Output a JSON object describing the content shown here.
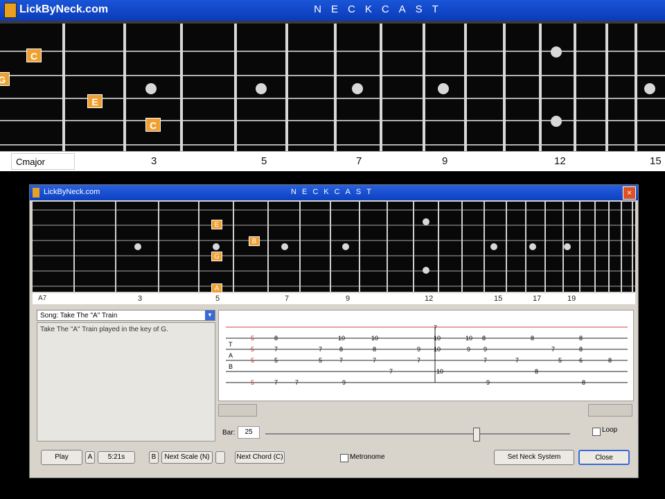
{
  "top_window": {
    "app_name": "LickByNeck.com",
    "brand": "NECKCAST",
    "chord_label": "Cmajor",
    "fret_markers": [
      "3",
      "5",
      "7",
      "9",
      "12",
      "15"
    ],
    "notes": [
      {
        "label": "C",
        "string": 2,
        "fret": 1
      },
      {
        "label": "E",
        "string": 4,
        "fret": 2
      },
      {
        "label": "C",
        "string": 5,
        "fret": 3
      },
      {
        "label": "G",
        "string": 3,
        "fret": 0
      }
    ]
  },
  "inner_window": {
    "app_name": "LickByNeck.com",
    "brand": "NECKCAST",
    "close_label": "×",
    "chord_label": "A7",
    "fret_markers": [
      "3",
      "5",
      "7",
      "9",
      "12",
      "15",
      "17",
      "19"
    ],
    "notes": [
      {
        "label": "E",
        "string": 1
      },
      {
        "label": "G",
        "string": 3
      },
      {
        "label": "B",
        "string": 2
      },
      {
        "label": "A",
        "string": 5
      }
    ],
    "song_label": "Song:",
    "song_value": "Take The \"A\" Train",
    "description": "Take The \"A\" Train played in the key of G.",
    "tab_numbers": [
      "7",
      "10",
      "10",
      "10",
      "10",
      "9",
      "8",
      "9",
      "7",
      "10",
      "7",
      "9",
      "7",
      "8",
      "10",
      "8",
      "7",
      "9",
      "9",
      "9",
      "9",
      "7",
      "10",
      "8",
      "8",
      "7",
      "5",
      "10",
      "9",
      "8",
      "7",
      "8"
    ],
    "speed_label": "Bar:",
    "speed_value": "25",
    "loop_label": "Loop",
    "play_label": "Play",
    "stop_label": "5:21s",
    "next_scale_label": "Next Scale (N)",
    "next_chord_label": "Next Chord (C)",
    "metronome_label": "Metronome",
    "neck_system_label": "Set Neck System",
    "close_button_label": "Close",
    "small_a": "A",
    "small_b": "B"
  }
}
